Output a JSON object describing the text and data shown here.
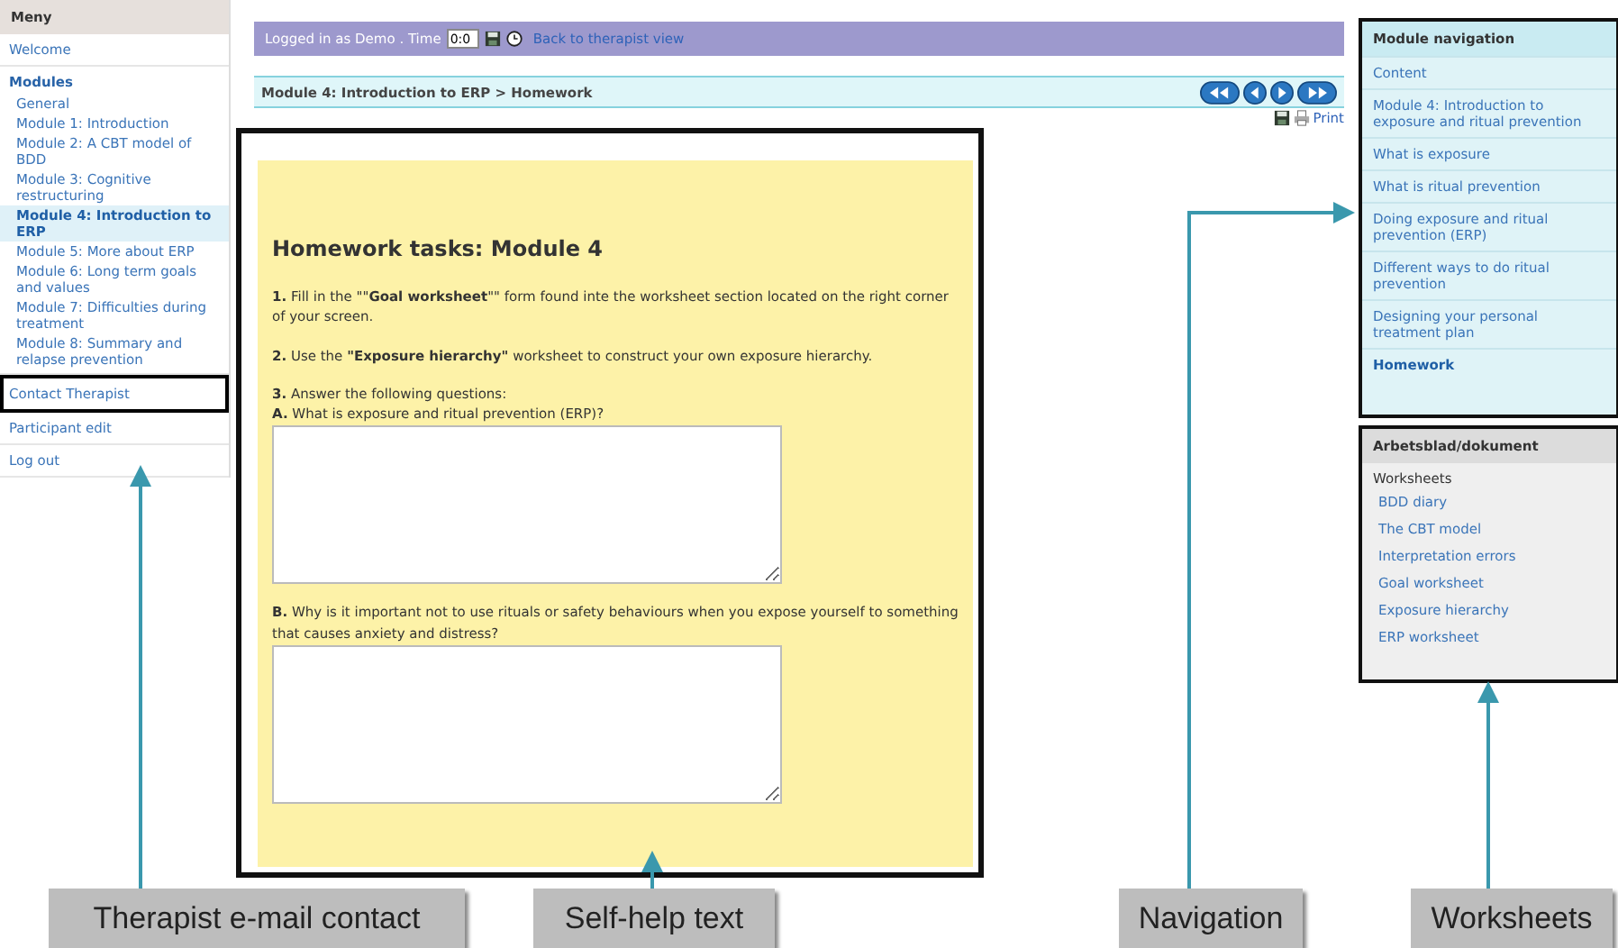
{
  "sidebar": {
    "title": "Meny",
    "items": [
      {
        "kind": "link",
        "label": "Welcome",
        "framed": false
      },
      {
        "kind": "heading",
        "label": "Modules",
        "framed": false,
        "children": [
          {
            "label": "General",
            "selected": false
          },
          {
            "label": "Module 1: Introduction",
            "selected": false
          },
          {
            "label": "Module 2: A CBT model of BDD",
            "selected": false
          },
          {
            "label": "Module 3: Cognitive restructuring",
            "selected": false
          },
          {
            "label": "Module 4: Introduction to ERP",
            "selected": true
          },
          {
            "label": "Module 5: More about ERP",
            "selected": false
          },
          {
            "label": "Module 6: Long term goals and values",
            "selected": false
          },
          {
            "label": "Module 7: Difficulties during treatment",
            "selected": false
          },
          {
            "label": "Module 8: Summary and relapse prevention",
            "selected": false
          }
        ]
      },
      {
        "kind": "link",
        "label": "Contact Therapist",
        "framed": true
      },
      {
        "kind": "link",
        "label": "Participant edit",
        "framed": false
      },
      {
        "kind": "link",
        "label": "Log out",
        "framed": false
      }
    ]
  },
  "top_bar": {
    "status": "Logged in as Demo . Time",
    "time_value": "0:0",
    "link": "Back to therapist view"
  },
  "breadcrumb": "Module 4: Introduction to ERP > Homework",
  "print_link": "Print",
  "content": {
    "heading": "Homework tasks: Module 4",
    "blocks": [
      {
        "kind": "paragraph",
        "text": "**1.** Fill in the \"\"**Goal worksheet**\"\" form found inte the worksheet section located on the right corner of your screen."
      },
      {
        "kind": "paragraph",
        "text": "**2.** Use the **\"Exposure hierarchy\"** worksheet to construct your own exposure hierarchy."
      },
      {
        "kind": "question",
        "intro": "**3.** Answer the following questions:",
        "text": "**A.** What is exposure and ritual prevention (ERP)?"
      },
      {
        "kind": "question",
        "text": "**B.** Why is it important not to use rituals or safety behaviours when you expose yourself to something that causes anxiety and distress?"
      }
    ]
  },
  "module_navigation": {
    "title": "Module navigation",
    "items": [
      {
        "label": "Content",
        "selected": false
      },
      {
        "label": "Module 4: Introduction to exposure and ritual prevention",
        "selected": false
      },
      {
        "label": "What is exposure",
        "selected": false
      },
      {
        "label": "What is ritual prevention",
        "selected": false
      },
      {
        "label": "Doing exposure and ritual prevention (ERP)",
        "selected": false
      },
      {
        "label": "Different ways to do ritual prevention",
        "selected": false
      },
      {
        "label": "Designing your personal treatment plan",
        "selected": false
      },
      {
        "label": "Homework",
        "selected": true
      }
    ]
  },
  "worksheets_panel": {
    "title": "Arbetsblad/dokument",
    "subtitle": "Worksheets",
    "items": [
      "BDD diary",
      "The CBT model",
      "Interpretation errors",
      "Goal worksheet",
      "Exposure hierarchy",
      "ERP worksheet"
    ]
  },
  "callouts": [
    "Therapist e-mail contact",
    "Self-help text",
    "Navigation",
    "Worksheets"
  ]
}
